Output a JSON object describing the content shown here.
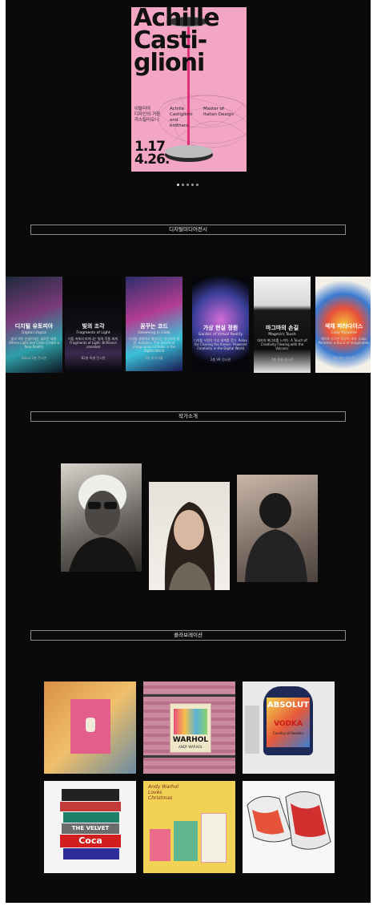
{
  "hero": {
    "poster": {
      "title_line1": "Achille",
      "title_line2": "Casti-",
      "title_line3": "glioni",
      "korean_text": "이탈리아\n디자인의 거장\n카스틸리오니",
      "name_text": "Achille\nCastiglioni\nand\nbrothers.",
      "subtitle_text": "Master of\nItalian Design",
      "dates": "1.17\n4.26."
    },
    "carousel_dots": 5,
    "active_dot": 0
  },
  "sections": {
    "digital": {
      "title": "디지털미디어전시"
    },
    "artists": {
      "title": "작가소개"
    },
    "collab": {
      "title": "콜라보레이션"
    }
  },
  "exhibitions": [
    {
      "title": "디지털 유토피아",
      "subtitle": "Digital Utopia",
      "desc": "빛과 색이 만들어내는 새로운 세계. Where Light and Color Create a New Reality",
      "venue": "Seoul 3층 전시관"
    },
    {
      "title": "빛의 조각",
      "subtitle": "Fragments of Light",
      "desc": "어둠 속에서 피어나는 빛의 작품 세계. Fragments of Light: Brilliance unveiled",
      "venue": "B2층 특별 전시관"
    },
    {
      "title": "꿈꾸는 코드",
      "subtitle": "Dreaming in Code",
      "desc": "디지털 세계에서 펼쳐지는 상상력의 향연. Solution: The Secret of Imagination Unfolds in the Digital World",
      "venue": "2층 미디어홀"
    },
    {
      "title": "가상 현실 정원",
      "subtitle": "Garden of Virtual Reality",
      "desc": "디지털 낙원의 가상 세계를 걷다. Relax for Chasing the Known: Powered Creativity in the Digital World",
      "venue": "2층 VR 전시관"
    },
    {
      "title": "마그마의 손길",
      "subtitle": "Magma's Touch",
      "desc": "대지의 에너지를 느끼다. A Touch of Creativity Flowing with the Volcanic",
      "venue": "3층 특별 전시관"
    },
    {
      "title": "색채 파라다이스",
      "subtitle": "Color Paradise",
      "desc": "색으로 가득한 환상의 세계. Color Paradise: a Burst of Imagination",
      "venue": "1층 메인 전시관"
    }
  ],
  "artists": [
    "artist-portrait-1",
    "artist-portrait-2",
    "artist-portrait-3"
  ],
  "collabs": {
    "warhol_box": "WARHOL",
    "warhol_sub": "ANDY WARHOL",
    "absolut": "ABSOLUT",
    "vodka": "VODKA",
    "vodka_sub": "Country of Sweden",
    "book_text": "THE VELVET",
    "coca": "Coca",
    "cards_brand": "Andy Warhol\nLoves\nChristmas"
  },
  "colors": {
    "background": "#0a0a0b",
    "poster_pink": "#f3a6c3",
    "border": "#8a8a8a"
  }
}
